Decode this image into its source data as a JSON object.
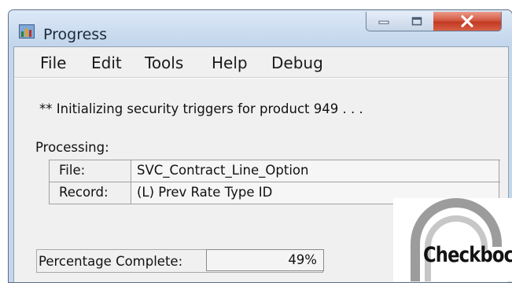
{
  "window": {
    "title": "Progress",
    "controls": [
      "minimize",
      "maximize",
      "close"
    ]
  },
  "menu": {
    "items": [
      "File",
      "Edit",
      "Tools",
      "Help",
      "Debug"
    ]
  },
  "status": {
    "message": "** Initializing security triggers for product 949 . . ."
  },
  "processing": {
    "label": "Processing:",
    "rows": [
      {
        "key": "File:",
        "value": "SVC_Contract_Line_Option"
      },
      {
        "key": "Record:",
        "value": "(L) Prev Rate Type ID"
      }
    ]
  },
  "progress": {
    "label": "Percentage Complete:",
    "value_text": "49%",
    "percent": 49
  },
  "overlay": {
    "brand_text": "Checkboc"
  },
  "colors": {
    "close_button": "#c33a22",
    "titlebar": "#c7d9ee"
  }
}
